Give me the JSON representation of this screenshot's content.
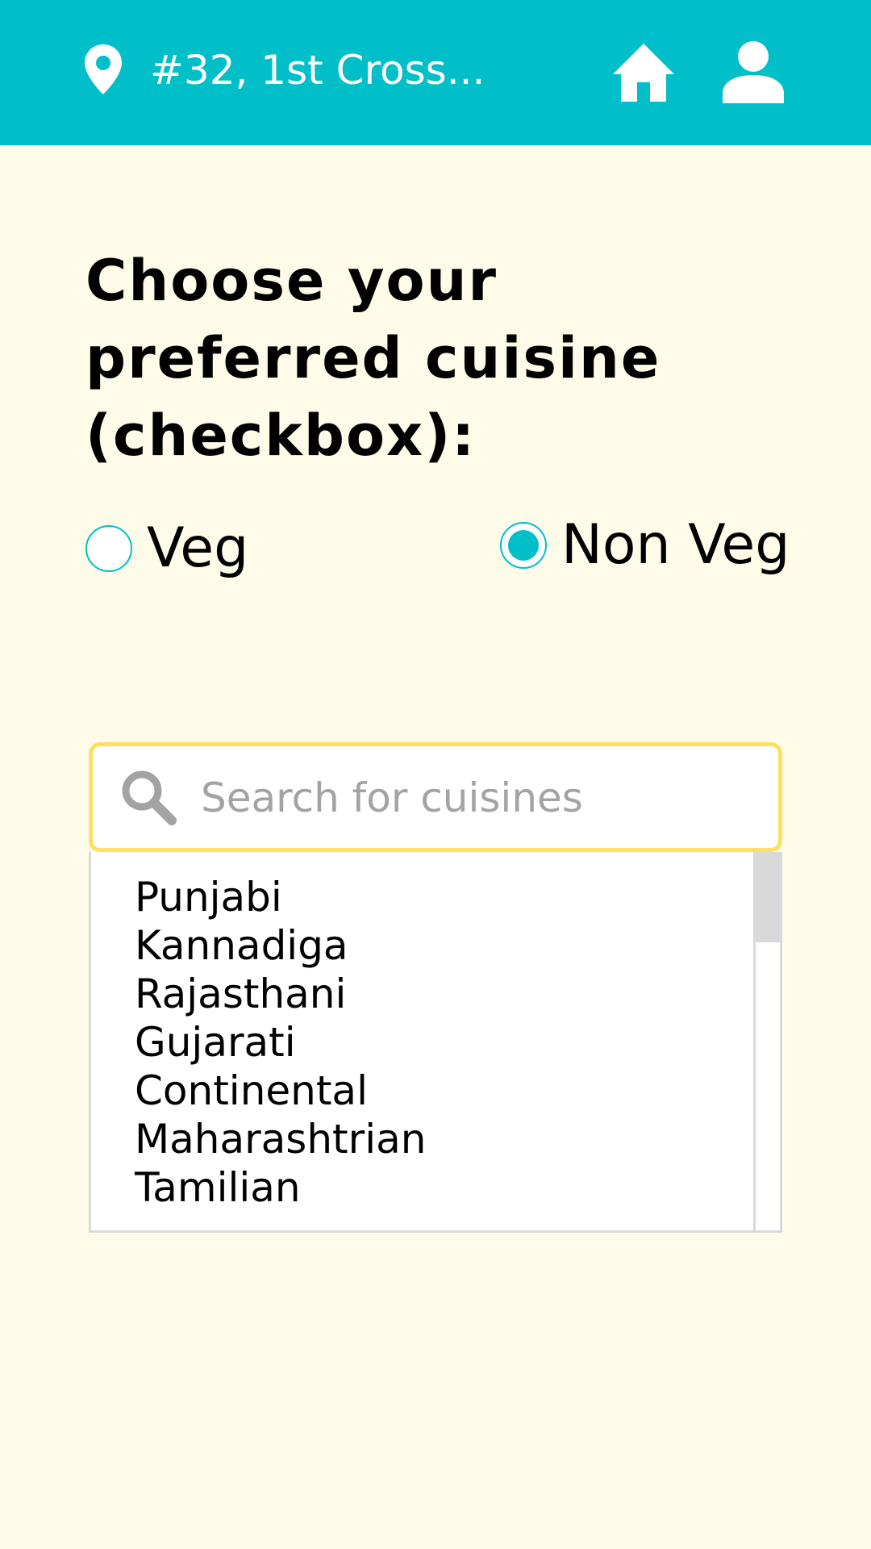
{
  "header": {
    "address": "#32, 1st Cross...",
    "icons": {
      "location": "map-pin-icon",
      "home": "home-icon",
      "profile": "user-icon"
    }
  },
  "heading": "Choose your preferred cuisine (checkbox):",
  "diet": {
    "options": [
      {
        "label": "Veg",
        "selected": false
      },
      {
        "label": "Non Veg",
        "selected": true
      }
    ]
  },
  "search": {
    "placeholder": "Search for cuisines",
    "value": ""
  },
  "cuisines": [
    "Punjabi",
    "Kannadiga",
    "Rajasthani",
    "Gujarati",
    "Continental",
    "Maharashtrian",
    "Tamilian"
  ],
  "colors": {
    "accent": "#00BFC8",
    "background": "#FEFBE8",
    "search_border": "#FCDF64",
    "placeholder": "#A3A3A3",
    "scrollbar": "#D9D9D9"
  }
}
